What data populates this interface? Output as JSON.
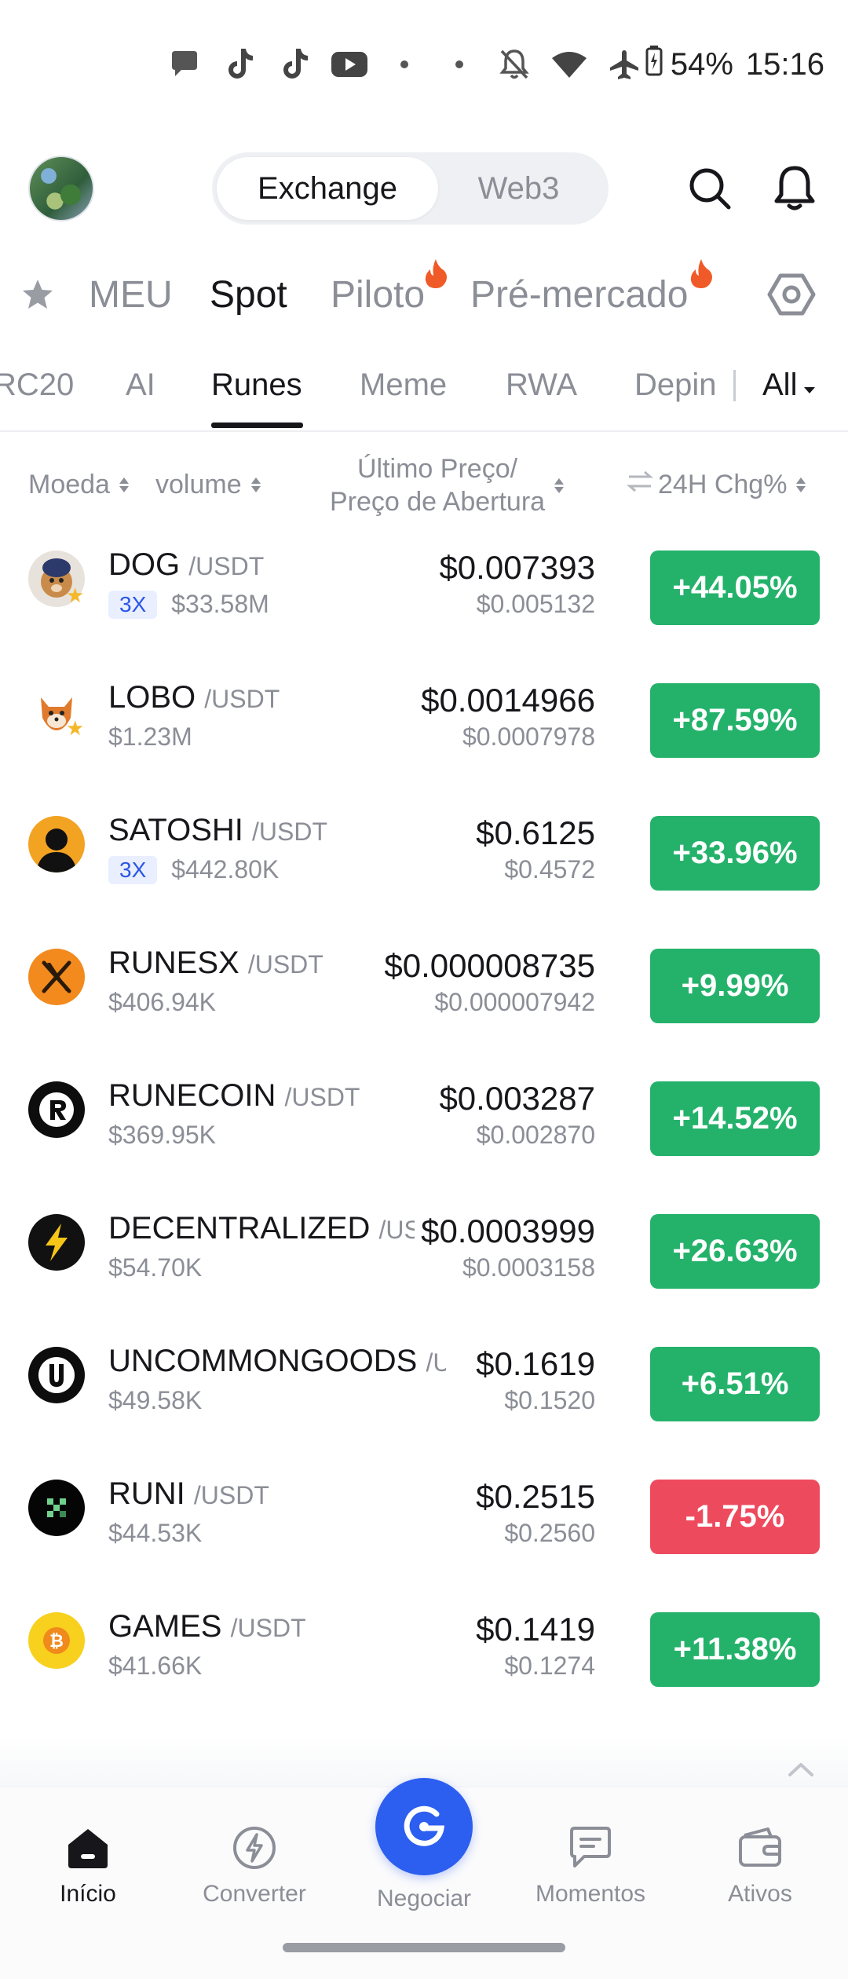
{
  "status_bar": {
    "battery": "54%",
    "time": "15:16",
    "icons": [
      "chat-bubble-icon",
      "tiktok-icon",
      "tiktok-icon",
      "youtube-icon",
      "dot-icon",
      "dot-icon",
      "notifications-off-icon",
      "wifi-icon",
      "airplane-icon",
      "battery-icon"
    ]
  },
  "header": {
    "segments": [
      "Exchange",
      "Web3"
    ],
    "active_segment": "Exchange"
  },
  "market_tabs": [
    "MEU",
    "Spot",
    "Piloto",
    "Pré-mercado"
  ],
  "active_market_tab": "Spot",
  "sub_tabs": [
    "RC20",
    "AI",
    "Runes",
    "Meme",
    "RWA",
    "Depin"
  ],
  "active_sub_tab": "Runes",
  "sub_tab_all": "All",
  "columns": {
    "coin": "Moeda",
    "volume": "volume",
    "last_price": "Último Preço/",
    "open_price": "Preço de Abertura",
    "change": "24H Chg%"
  },
  "rows": [
    {
      "symbol": "DOG",
      "quote": "/USDT",
      "leverage": "3X",
      "volume": "$33.58M",
      "price": "$0.007393",
      "open": "$0.005132",
      "change": "+44.05%",
      "direction": "up",
      "favorite": true
    },
    {
      "symbol": "LOBO",
      "quote": "/USDT",
      "leverage": "",
      "volume": "$1.23M",
      "price": "$0.0014966",
      "open": "$0.0007978",
      "change": "+87.59%",
      "direction": "up",
      "favorite": true
    },
    {
      "symbol": "SATOSHI",
      "quote": "/USDT",
      "leverage": "3X",
      "volume": "$442.80K",
      "price": "$0.6125",
      "open": "$0.4572",
      "change": "+33.96%",
      "direction": "up",
      "favorite": false
    },
    {
      "symbol": "RUNESX",
      "quote": "/USDT",
      "leverage": "",
      "volume": "$406.94K",
      "price": "$0.000008735",
      "open": "$0.000007942",
      "change": "+9.99%",
      "direction": "up",
      "favorite": false
    },
    {
      "symbol": "RUNECOIN",
      "quote": "/USDT",
      "leverage": "",
      "volume": "$369.95K",
      "price": "$0.003287",
      "open": "$0.002870",
      "change": "+14.52%",
      "direction": "up",
      "favorite": false
    },
    {
      "symbol": "DECENTRALIZED",
      "quote": "/USDT",
      "leverage": "",
      "volume": "$54.70K",
      "price": "$0.0003999",
      "open": "$0.0003158",
      "change": "+26.63%",
      "direction": "up",
      "favorite": false
    },
    {
      "symbol": "UNCOMMONGOODS",
      "quote": "/USDT",
      "leverage": "",
      "volume": "$49.58K",
      "price": "$0.1619",
      "open": "$0.1520",
      "change": "+6.51%",
      "direction": "up",
      "favorite": false
    },
    {
      "symbol": "RUNI",
      "quote": "/USDT",
      "leverage": "",
      "volume": "$44.53K",
      "price": "$0.2515",
      "open": "$0.2560",
      "change": "-1.75%",
      "direction": "down",
      "favorite": false
    },
    {
      "symbol": "GAMES",
      "quote": "/USDT",
      "leverage": "",
      "volume": "$41.66K",
      "price": "$0.1419",
      "open": "$0.1274",
      "change": "+11.38%",
      "direction": "up",
      "favorite": false
    }
  ],
  "colors": {
    "up": "#24b26b",
    "down": "#ee4a5e",
    "accent": "#2c5ef0",
    "flame": "#f05a28"
  },
  "bottom_nav": [
    {
      "label": "Início",
      "icon": "home-icon",
      "active": true
    },
    {
      "label": "Converter",
      "icon": "lightning-icon",
      "active": false
    },
    {
      "label": "Negociar",
      "icon": "trade-icon",
      "active": false
    },
    {
      "label": "Momentos",
      "icon": "chat-icon",
      "active": false
    },
    {
      "label": "Ativos",
      "icon": "wallet-icon",
      "active": false
    }
  ]
}
